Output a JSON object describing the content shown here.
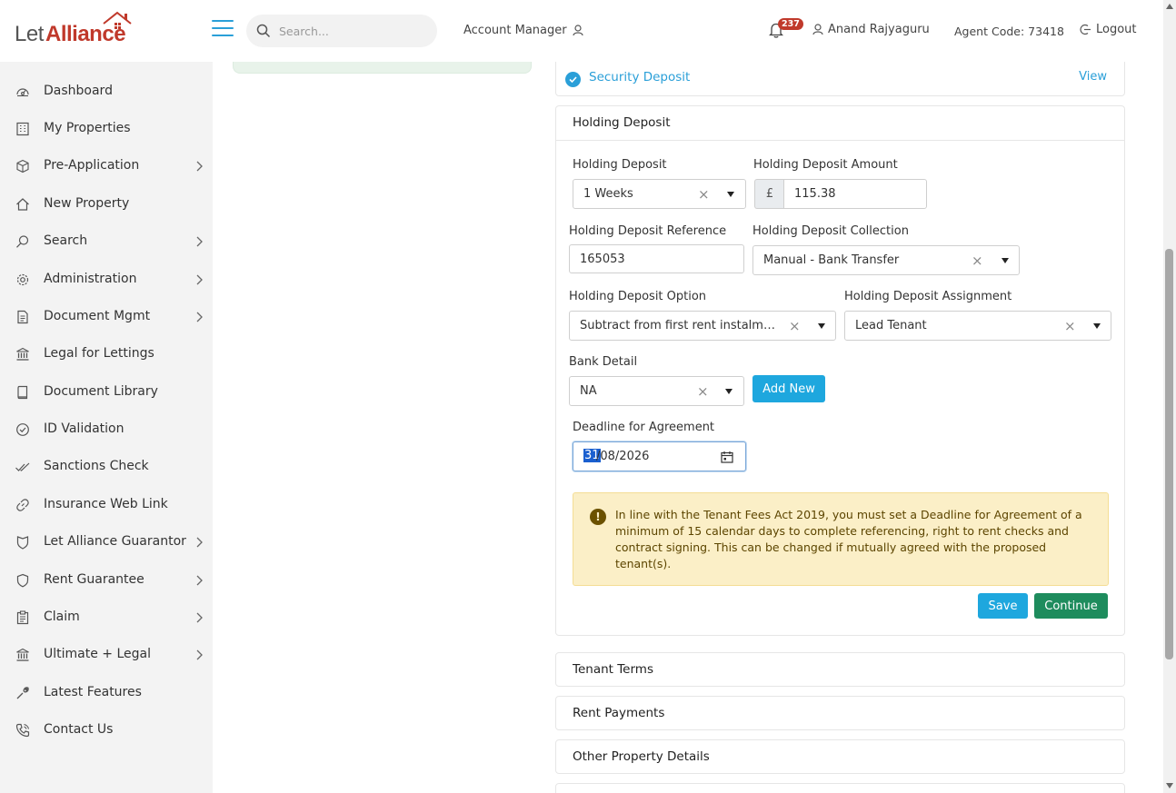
{
  "header": {
    "logo_let": "Let",
    "logo_alliance": "Alliance",
    "search_placeholder": "Search...",
    "account_manager": "Account Manager",
    "notification_count": "237",
    "user_name": "Anand Rajyaguru",
    "agent_code": "Agent Code: 73418",
    "logout": "Logout"
  },
  "sidebar": {
    "items": [
      {
        "label": "Dashboard",
        "icon": "dashboard-icon",
        "has_submenu": false
      },
      {
        "label": "My Properties",
        "icon": "building-icon",
        "has_submenu": false
      },
      {
        "label": "Pre-Application",
        "icon": "box-icon",
        "has_submenu": true
      },
      {
        "label": "New Property",
        "icon": "home-icon",
        "has_submenu": false
      },
      {
        "label": "Search",
        "icon": "search-icon",
        "has_submenu": true
      },
      {
        "label": "Administration",
        "icon": "gear-icon",
        "has_submenu": true
      },
      {
        "label": "Document Mgmt",
        "icon": "document-icon",
        "has_submenu": true
      },
      {
        "label": "Legal for Lettings",
        "icon": "bank-icon",
        "has_submenu": false
      },
      {
        "label": "Document Library",
        "icon": "book-icon",
        "has_submenu": false
      },
      {
        "label": "ID Validation",
        "icon": "check-circle-icon",
        "has_submenu": false
      },
      {
        "label": "Sanctions Check",
        "icon": "double-check-icon",
        "has_submenu": false
      },
      {
        "label": "Insurance Web Link",
        "icon": "link-icon",
        "has_submenu": false
      },
      {
        "label": "Let Alliance Guarantor",
        "icon": "shield-icon",
        "has_submenu": true
      },
      {
        "label": "Rent Guarantee",
        "icon": "shield-outline-icon",
        "has_submenu": true
      },
      {
        "label": "Claim",
        "icon": "clipboard-icon",
        "has_submenu": true
      },
      {
        "label": "Ultimate + Legal",
        "icon": "bank-icon",
        "has_submenu": true
      },
      {
        "label": "Latest Features",
        "icon": "wrench-icon",
        "has_submenu": false
      },
      {
        "label": "Contact Us",
        "icon": "phone-icon",
        "has_submenu": false
      }
    ]
  },
  "security_deposit": {
    "label": "Security Deposit",
    "view": "View"
  },
  "holding_deposit": {
    "title": "Holding Deposit",
    "deposit_label": "Holding Deposit",
    "deposit_value": "1 Weeks",
    "amount_label": "Holding Deposit Amount",
    "currency": "£",
    "amount_value": "115.38",
    "reference_label": "Holding Deposit Reference",
    "reference_value": "165053",
    "collection_label": "Holding Deposit Collection",
    "collection_value": "Manual - Bank Transfer",
    "option_label": "Holding Deposit Option",
    "option_value": "Subtract from first rent instalme...",
    "assignment_label": "Holding Deposit Assignment",
    "assignment_value": "Lead Tenant",
    "bank_label": "Bank Detail",
    "bank_value": "NA",
    "add_new": "Add New",
    "deadline_label": "Deadline for Agreement",
    "deadline_day": "31",
    "deadline_rest": "/08/2026",
    "alert_text": "In line with the Tenant Fees Act 2019, you must set a Deadline for Agreement of a minimum of 15 calendar days to complete referencing, right to rent checks and contract signing. This can be changed if mutually agreed with the proposed tenant(s).",
    "save": "Save",
    "continue": "Continue"
  },
  "sections": {
    "tenant_terms": "Tenant Terms",
    "rent_payments": "Rent Payments",
    "other_property_details": "Other Property Details"
  },
  "colors": {
    "accent": "#1ea7de",
    "brand_red": "#c0392b",
    "continue_green": "#1e8c5d",
    "alert_bg": "#fbefc7"
  }
}
